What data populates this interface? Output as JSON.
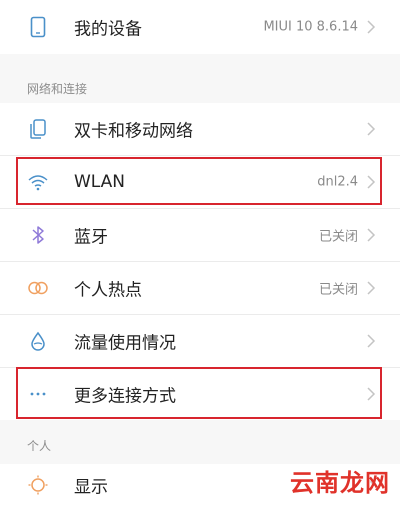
{
  "top_row": {
    "label": "我的设备",
    "value": "MIUI 10 8.6.14",
    "icon": "phone-icon"
  },
  "sections": {
    "network_header": "网络和连接",
    "personal_header": "个人"
  },
  "network_items": [
    {
      "label": "双卡和移动网络",
      "value": "",
      "icon": "sim-cards-icon"
    },
    {
      "label": "WLAN",
      "value": "dnl2.4",
      "icon": "wifi-icon"
    },
    {
      "label": "蓝牙",
      "value": "已关闭",
      "icon": "bluetooth-icon"
    },
    {
      "label": "个人热点",
      "value": "已关闭",
      "icon": "hotspot-icon"
    },
    {
      "label": "流量使用情况",
      "value": "",
      "icon": "data-usage-icon"
    },
    {
      "label": "更多连接方式",
      "value": "",
      "icon": "more-dots-icon"
    }
  ],
  "personal_items": [
    {
      "label": "显示",
      "value": "",
      "icon": "display-brightness-icon"
    }
  ],
  "watermark": "云南龙网",
  "colors": {
    "highlight": "#d8252e",
    "icon_blue": "#4a90c9",
    "icon_purple": "#8f7ad8",
    "icon_orange": "#f0a060",
    "watermark": "#e0322a"
  }
}
